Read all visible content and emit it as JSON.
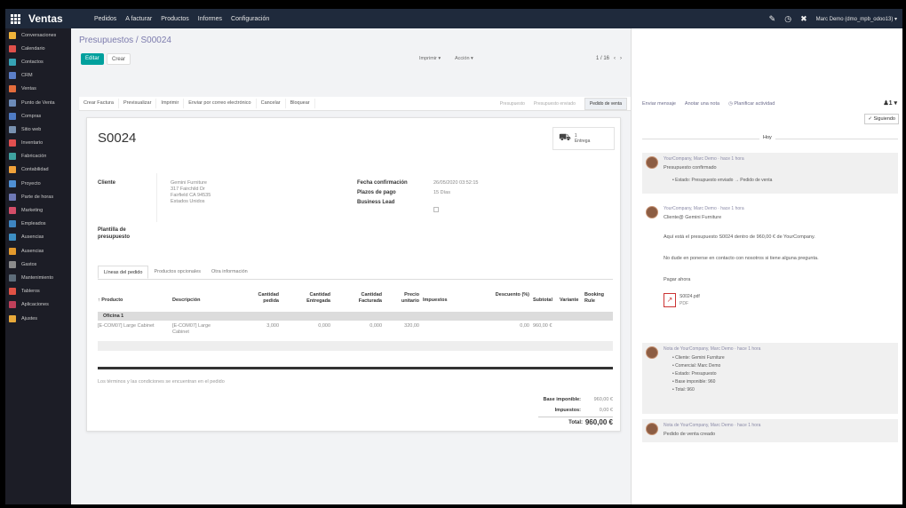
{
  "topbar": {
    "app_title": "Ventas",
    "menu": [
      "Pedidos",
      "A facturar",
      "Productos",
      "Informes",
      "Configuración"
    ],
    "user": "Marc Demo (dmo_mpb_odoo13) ▾",
    "icons": [
      "chat-icon",
      "clock-icon",
      "close-icon"
    ]
  },
  "sidebar": {
    "items": [
      {
        "label": "Conversaciones",
        "color": "#f0b43a"
      },
      {
        "label": "Calendario",
        "color": "#e0504a"
      },
      {
        "label": "Contactos",
        "color": "#36a3b5"
      },
      {
        "label": "CRM",
        "color": "#5b7fc9"
      },
      {
        "label": "Ventas",
        "color": "#e46d3c"
      },
      {
        "label": "Punto de Venta",
        "color": "#6c8bb8"
      },
      {
        "label": "Compras",
        "color": "#4f7bc4"
      },
      {
        "label": "Sitio web",
        "color": "#7891b0"
      },
      {
        "label": "Inventario",
        "color": "#e24f4f"
      },
      {
        "label": "Fabricación",
        "color": "#3fa3a0"
      },
      {
        "label": "Contabilidad",
        "color": "#f0a23a"
      },
      {
        "label": "Proyecto",
        "color": "#4f90d4"
      },
      {
        "label": "Parte de horas",
        "color": "#6e79b6"
      },
      {
        "label": "Marketing",
        "color": "#d34d68"
      },
      {
        "label": "Empleados",
        "color": "#3e86c2"
      },
      {
        "label": "Ausencias",
        "color": "#3d8fc4"
      },
      {
        "label": "Ausencias",
        "color": "#e39a2d"
      },
      {
        "label": "Gastos",
        "color": "#8c8c8c"
      },
      {
        "label": "Mantenimiento",
        "color": "#5e6d7a"
      },
      {
        "label": "Tableros",
        "color": "#e05245"
      },
      {
        "label": "Aplicaciones",
        "color": "#c0405a"
      },
      {
        "label": "Ajustes",
        "color": "#e8a93a"
      }
    ]
  },
  "control": {
    "breadcrumb": "Presupuestos / S00024",
    "edit_label": "Editar",
    "create_label": "Crear",
    "print_label": "Imprimir ▾",
    "action_label": "Acción ▾",
    "pager": "1 / 16",
    "prev_icon": "chevron-left-icon",
    "next_icon": "chevron-right-icon"
  },
  "actionbar": {
    "buttons": [
      "Crear Factura",
      "Previsualizar",
      "Imprimir",
      "Enviar por correo electrónico",
      "Cancelar",
      "Bloquear"
    ],
    "stages": [
      "Presupuesto",
      "Presupuesto enviado",
      "Pedido de venta"
    ],
    "active_stage": "Pedido de venta"
  },
  "form": {
    "name": "S0024",
    "delivery_count": "1",
    "delivery_label": "Entrega",
    "client_label": "Cliente",
    "client_lines": [
      "Gemini Furniture",
      "317 Fairchild Dr",
      "Fairfield CA 94535",
      "Estados Unidos"
    ],
    "template_label": "Plantilla de presupuesto",
    "confirm_label": "Fecha confirmación",
    "confirm_value": "26/05/2020 03:52:15",
    "terms_label": "Plazos de pago",
    "terms_value": "15 Días",
    "lead_label": "Business Lead"
  },
  "tabs": [
    "Líneas del pedido",
    "Productos opcionales",
    "Otra información"
  ],
  "order_lines": {
    "headers": [
      "Producto",
      "Descripción",
      "Cantidad pedida",
      "Cantidad Entregada",
      "Cantidad Facturada",
      "Precio unitario",
      "Impuestos",
      "Descuento (%)",
      "Subtotal",
      "Variante",
      "Booking Rule"
    ],
    "section": "Oficina 1",
    "rows": [
      {
        "product": "[E-COM07] Large Cabinet",
        "description": "[E-COM07] Large Cabinet",
        "qty": "3,000",
        "delivered": "0,000",
        "invoiced": "0,000",
        "price": "320,00",
        "taxes": "",
        "discount": "0,00",
        "subtotal": "960,00 €",
        "variant": "",
        "rule": ""
      }
    ]
  },
  "totals": {
    "terms_note": "Los términos y las condiciones se encuentran en el pedido",
    "base_label": "Base imponible:",
    "base_value": "960,00 €",
    "tax_label": "Impuestos:",
    "tax_value": "0,00 €",
    "total_label": "Total:",
    "total_value": "960,00 €"
  },
  "chatter": {
    "send_message": "Enviar mensaje",
    "log_note": "Anotar una nota",
    "schedule": "Planificar actividad",
    "followers": "1",
    "following": "✓ Siguiendo",
    "today": "Hoy",
    "messages": [
      {
        "author": "YourCompany, Marc Demo · hace 1 hora",
        "lines": [
          "Presupuesto confirmado"
        ],
        "bullets": [
          "Estado: Presupuesto enviado → Pedido de venta"
        ],
        "note": true
      },
      {
        "author": "YourCompany, Marc Demo · hace 1 hora",
        "lines": [
          "Cliente@ Gemini Furniture",
          "Aquí está el presupuesto S0024 dentro de 960,00 € de YourCompany.",
          "No dude en ponerse en contacto con nosotros si tiene alguna pregunta.",
          "Pagar ahora"
        ],
        "bullets": [],
        "note": false,
        "attachment": {
          "name": "S0024.pdf",
          "ext": "PDF"
        }
      },
      {
        "author": "Nota de YourCompany, Marc Demo · hace 1 hora",
        "lines": [],
        "bullets": [
          "Cliente: Gemini Furniture",
          "Comercial: Marc Demo",
          "Estado: Presupuesto",
          "Base imponible: 960",
          "Total: 960"
        ],
        "note": true
      },
      {
        "author": "Nota de YourCompany, Marc Demo · hace 1 hora",
        "lines": [
          "Pedido de venta creado"
        ],
        "bullets": [],
        "note": true
      }
    ]
  }
}
